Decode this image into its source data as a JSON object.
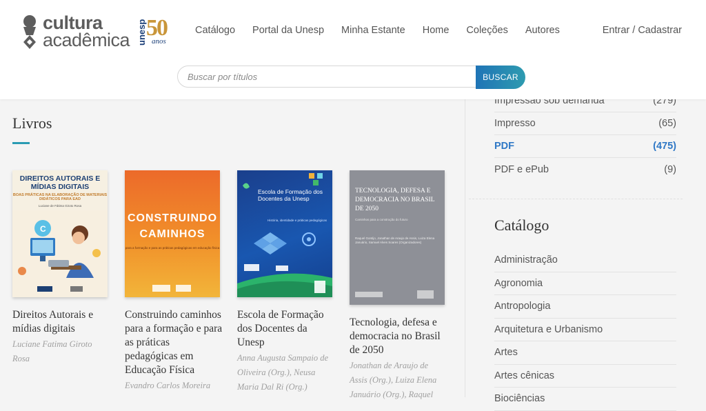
{
  "header": {
    "logo": {
      "line1": "cultura",
      "line2": "acadêmica"
    },
    "badge": {
      "brand": "unesp",
      "number": "50",
      "label": "anos"
    },
    "nav": [
      "Catálogo",
      "Portal da Unesp",
      "Minha Estante",
      "Home",
      "Coleções",
      "Autores"
    ],
    "login_label": "Entrar / Cadastrar",
    "search": {
      "placeholder": "Buscar por títulos",
      "button_label": "BUSCAR"
    }
  },
  "main": {
    "section_title": "Livros",
    "books": [
      {
        "title": "Direitos Autorais e mídias digitais",
        "author": "Luciane Fatima Giroto Rosa",
        "cover": {
          "line1": "DIREITOS AUTORAIS E MÍDIAS DIGITAIS",
          "line2": "BOAS PRÁTICAS NA ELABORAÇÃO DE MATERIAIS DIDÁTICOS PARA EAD",
          "line3": "Luciane de Fátima Giroto Rosa"
        }
      },
      {
        "title": "Construindo caminhos para a formação e para as práticas pedagógicas em Educação Física",
        "author": "Evandro Carlos Moreira",
        "cover": {
          "line1": "CONSTRUINDO CAMINHOS",
          "line2": "para a formação e para as práticas pedagógicas em educação física"
        }
      },
      {
        "title": "Escola de Formação dos Docentes da Unesp",
        "author": "Anna Augusta Sampaio de Oliveira (Org.), Neusa Maria Dal Ri (Org.)",
        "cover": {
          "line1": "Escola de Formação dos Docentes da Unesp",
          "line2": "História, identidade e práticas pedagógicas"
        }
      },
      {
        "title": "Tecnologia, defesa e democracia no Brasil de 2050",
        "author": "Jonathan de Araujo de Assis (Org.), Luiza Elena Januário (Org.), Raquel",
        "cover": {
          "line1": "TECNOLOGIA, DEFESA E DEMOCRACIA NO BRASIL DE 2050",
          "line2": "Caminhos para a construção do futuro",
          "line3": "Raquel Gontijo, Jonathan de Araujo de Assis, Luiza Elena Januário, Samuel Alves Soares (Organizadores)"
        }
      }
    ]
  },
  "sidebar": {
    "formats": [
      {
        "label": "Impressão sob demanda",
        "count": "(279)"
      },
      {
        "label": "Impresso",
        "count": "(65)"
      },
      {
        "label": "PDF",
        "count": "(475)"
      },
      {
        "label": "PDF e ePub",
        "count": "(9)"
      }
    ],
    "catalog_title": "Catálogo",
    "catalog": [
      "Administração",
      "Agronomia",
      "Antropologia",
      "Arquitetura e Urbanismo",
      "Artes",
      "Artes cênicas",
      "Biociências"
    ]
  },
  "colors": {
    "accent": "#2a9bb3",
    "active_link": "#2f78c6",
    "button_start": "#1f74b6",
    "button_end": "#2e9bb0"
  }
}
